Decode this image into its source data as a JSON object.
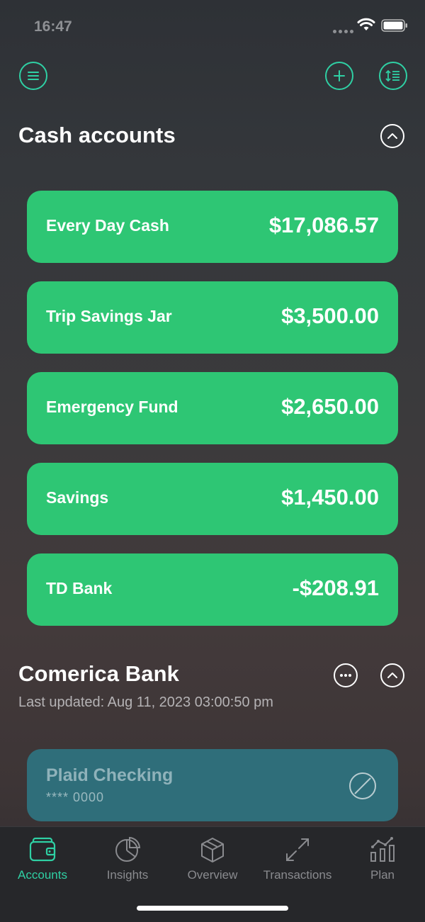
{
  "status_bar": {
    "time": "16:47"
  },
  "colors": {
    "accent": "#2fd0a4",
    "card_green": "#2ec674",
    "card_teal": "#2f6e7a",
    "tab_inactive": "#8a8b8f"
  },
  "header": {
    "icons": [
      "menu-icon",
      "plus-icon",
      "sort-icon"
    ]
  },
  "cash_section": {
    "title": "Cash accounts",
    "accounts": [
      {
        "name": "Every Day Cash",
        "amount": "$17,086.57"
      },
      {
        "name": "Trip Savings Jar",
        "amount": "$3,500.00"
      },
      {
        "name": "Emergency Fund",
        "amount": "$2,650.00"
      },
      {
        "name": "Savings",
        "amount": "$1,450.00"
      },
      {
        "name": "TD Bank",
        "amount": "-$208.91"
      }
    ]
  },
  "comerica_section": {
    "title": "Comerica Bank",
    "last_updated": "Last updated: Aug 11, 2023 03:00:50 pm",
    "accounts": [
      {
        "name": "Plaid Checking",
        "mask": "**** 0000",
        "status_icon": "disabled-icon"
      }
    ]
  },
  "tabs": [
    {
      "label": "Accounts",
      "icon": "wallet-icon",
      "active": true
    },
    {
      "label": "Insights",
      "icon": "pie-chart-icon",
      "active": false
    },
    {
      "label": "Overview",
      "icon": "cube-icon",
      "active": false
    },
    {
      "label": "Transactions",
      "icon": "transfer-arrows-icon",
      "active": false
    },
    {
      "label": "Plan",
      "icon": "bar-chart-icon",
      "active": false
    }
  ]
}
